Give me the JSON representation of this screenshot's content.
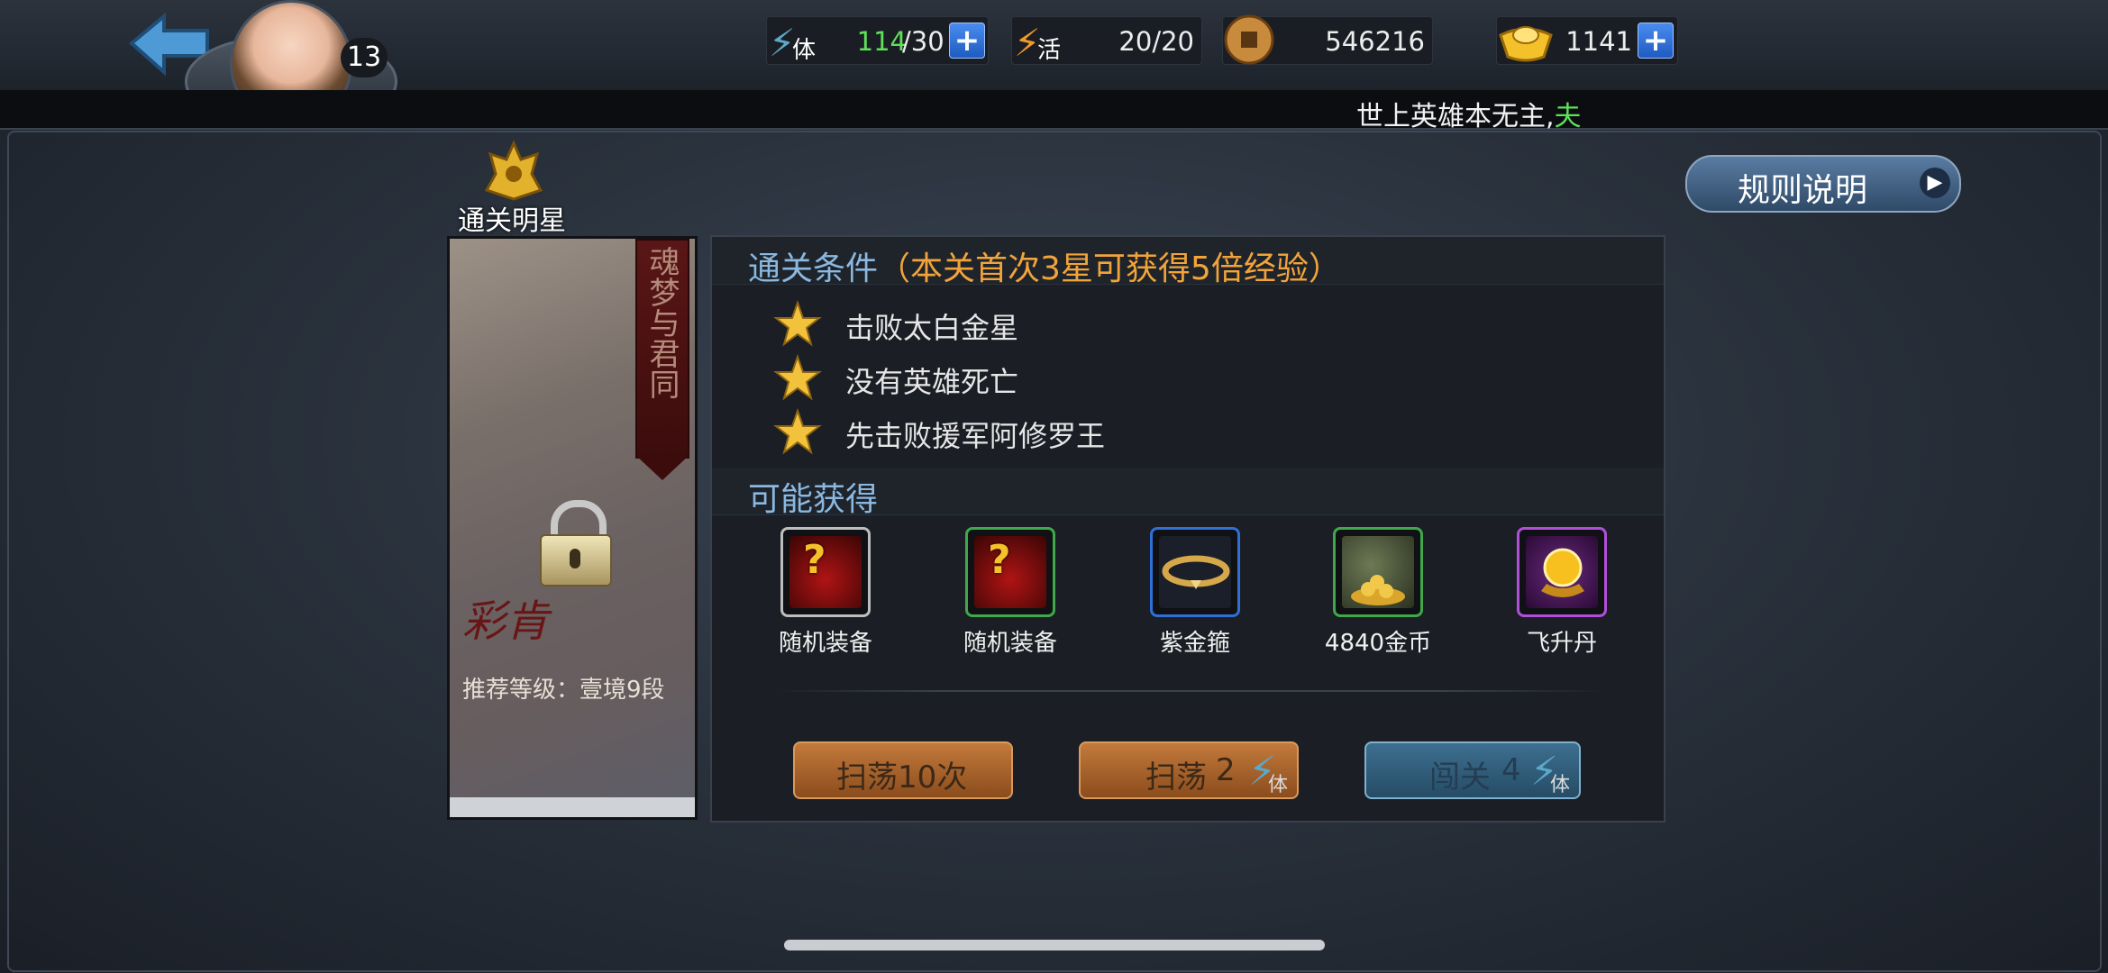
{
  "hud": {
    "player_level": "13",
    "stamina": {
      "icon": "stamina-bolt-icon",
      "label": "体",
      "current": "114",
      "max": "/30"
    },
    "vitality": {
      "icon": "vitality-bolt-icon",
      "label": "活",
      "value": "20/20"
    },
    "coins": {
      "icon": "copper-coin-icon",
      "value": "546216"
    },
    "ingots": {
      "icon": "gold-ingot-icon",
      "value": "1141"
    }
  },
  "ticker": {
    "text": "世上英雄本无主,",
    "highlight": "夫"
  },
  "rules_button": {
    "label": "规则说明"
  },
  "stage": {
    "star_title": "通关明星",
    "banner": "魂梦与君同",
    "recommended": "推荐等级：壹境9段",
    "logo": "彩肯"
  },
  "conditions": {
    "title": "通关条件",
    "subtitle": "（本关首次3星可获得5倍经验）",
    "items": [
      "击败太白金星",
      "没有英雄死亡",
      "先击败援军阿修罗王"
    ]
  },
  "rewards": {
    "title": "可能获得",
    "items": [
      {
        "label": "随机装备",
        "icon": "random-equipment-icon",
        "color": "#bdbdbd"
      },
      {
        "label": "随机装备",
        "icon": "random-equipment-icon",
        "color": "#3fa84a"
      },
      {
        "label": "紫金箍",
        "icon": "golden-ring-icon",
        "color": "#2f6fd6"
      },
      {
        "label": "4840金币",
        "icon": "gold-coins-bag-icon",
        "color": "#3fa84a"
      },
      {
        "label": "飞升丹",
        "icon": "ascension-pill-icon",
        "color": "#b24fd8"
      }
    ]
  },
  "actions": {
    "sweep10": "扫荡10次",
    "sweep": "扫荡",
    "sweep_cost": "2",
    "battle": "闯关",
    "battle_cost": "4",
    "cost_unit": "体"
  }
}
